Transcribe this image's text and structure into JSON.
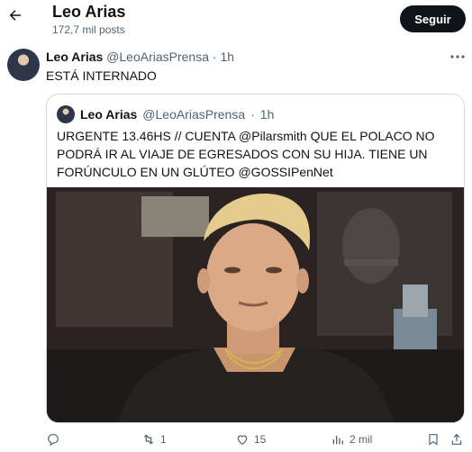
{
  "header": {
    "title": "Leo Arias",
    "subtitle": "172,7 mil posts",
    "follow_label": "Seguir"
  },
  "tweet": {
    "author_name": "Leo Arias",
    "author_handle": "@LeoAriasPrensa",
    "separator": "·",
    "time": "1h",
    "text": "ESTÁ INTERNADO"
  },
  "quote": {
    "author_name": "Leo Arias",
    "author_handle": "@LeoAriasPrensa",
    "separator": "·",
    "time": "1h",
    "text": "URGENTE 13.46HS // CUENTA @Pilarsmith QUE EL POLACO NO PODRÁ IR AL VIAJE DE EGRESADOS CON SU HIJA. TIENE UN FORÚNCULO EN UN GLÚTEO  @GOSSIPenNet"
  },
  "actions": {
    "reply_count": "",
    "repost_count": "1",
    "like_count": "15",
    "views_count": "2 mil"
  },
  "icons": [
    "back-arrow-icon",
    "more-icon",
    "reply-icon",
    "repost-icon",
    "like-icon",
    "views-icon",
    "bookmark-icon",
    "share-icon"
  ],
  "colors": {
    "primary_text": "#0f1419",
    "secondary_text": "#536471",
    "border": "#cfd9de",
    "follow_bg": "#0f1419"
  }
}
